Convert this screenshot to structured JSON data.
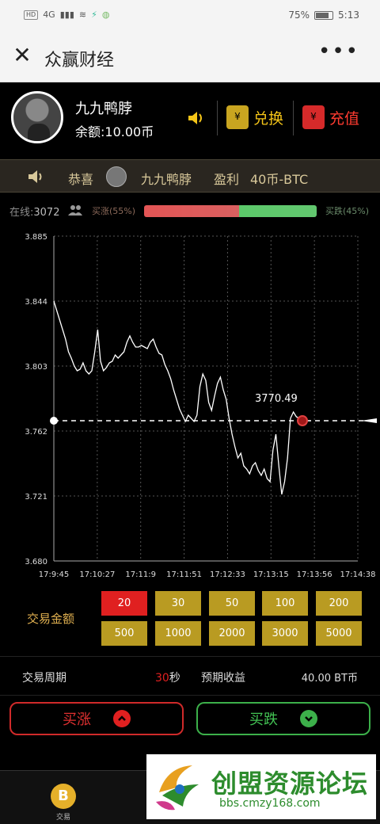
{
  "status_bar": {
    "network": "4G",
    "battery": "75%",
    "time": "5:13"
  },
  "titlebar": {
    "title": "众赢财经"
  },
  "user": {
    "name": "九九鸭脖",
    "balance": "余额:10.00币"
  },
  "actions": {
    "exchange_label": "兑换",
    "recharge_label": "充值"
  },
  "banner": {
    "congrats": "恭喜",
    "user": "九九鸭脖",
    "profit_label": "盈利",
    "profit_value": "40币-BTC"
  },
  "sentiment": {
    "online_label": "在线:",
    "online_count": "3072",
    "buy_up": "买涨(55%)",
    "buy_down": "买跌(45%)",
    "up_fraction": 0.55
  },
  "chart_data": {
    "type": "line",
    "x_ticks": [
      "17:9:45",
      "17:10:27",
      "17:11:9",
      "17:11:51",
      "17:12:33",
      "17:13:15",
      "17:13:56",
      "17:14:38"
    ],
    "y_ticks": [
      "3.885",
      "3.844",
      "3.803",
      "3.762",
      "3.721",
      "3.680"
    ],
    "ylim": [
      3.68,
      3.885
    ],
    "current_price": "3770.49",
    "reference_level": 3.7685,
    "series": [
      {
        "values": [
          3.844,
          3.838,
          3.832,
          3.826,
          3.82,
          3.812,
          3.808,
          3.803,
          3.8,
          3.801,
          3.805,
          3.8,
          3.798,
          3.8,
          3.812,
          3.826,
          3.806,
          3.8,
          3.802,
          3.805,
          3.806,
          3.81,
          3.808,
          3.81,
          3.812,
          3.818,
          3.822,
          3.818,
          3.815,
          3.815,
          3.816,
          3.815,
          3.814,
          3.818,
          3.82,
          3.815,
          3.811,
          3.81,
          3.804,
          3.8,
          3.795,
          3.788,
          3.782,
          3.776,
          3.772,
          3.768,
          3.772,
          3.77,
          3.768,
          3.772,
          3.79,
          3.798,
          3.794,
          3.78,
          3.775,
          3.784,
          3.792,
          3.796,
          3.788,
          3.782,
          3.77,
          3.76,
          3.752,
          3.745,
          3.748,
          3.74,
          3.738,
          3.735,
          3.74,
          3.742,
          3.737,
          3.734,
          3.738,
          3.732,
          3.73,
          3.75,
          3.76,
          3.74,
          3.722,
          3.73,
          3.745,
          3.77,
          3.774,
          3.771,
          3.77
        ]
      }
    ]
  },
  "amounts": {
    "label": "交易金额",
    "row1": [
      "20",
      "30",
      "50",
      "100",
      "200"
    ],
    "row2": [
      "500",
      "1000",
      "2000",
      "3000",
      "5000"
    ],
    "selected": "20"
  },
  "trade": {
    "period_label": "交易周期",
    "period_value": "30",
    "period_unit": "秒",
    "expected_label": "预期收益",
    "expected_value": "40.00 BT币"
  },
  "buttons": {
    "buy_up": "买涨",
    "buy_down": "买跌"
  },
  "nav": {
    "trade_label": "交易",
    "coin_symbol": "B"
  },
  "watermark": {
    "text": "创盟资源论坛",
    "url": "bbs.cmzy168.com"
  },
  "colors": {
    "accent_gold": "#b99b22",
    "up_red": "#e02020",
    "down_green": "#3cb04a"
  }
}
